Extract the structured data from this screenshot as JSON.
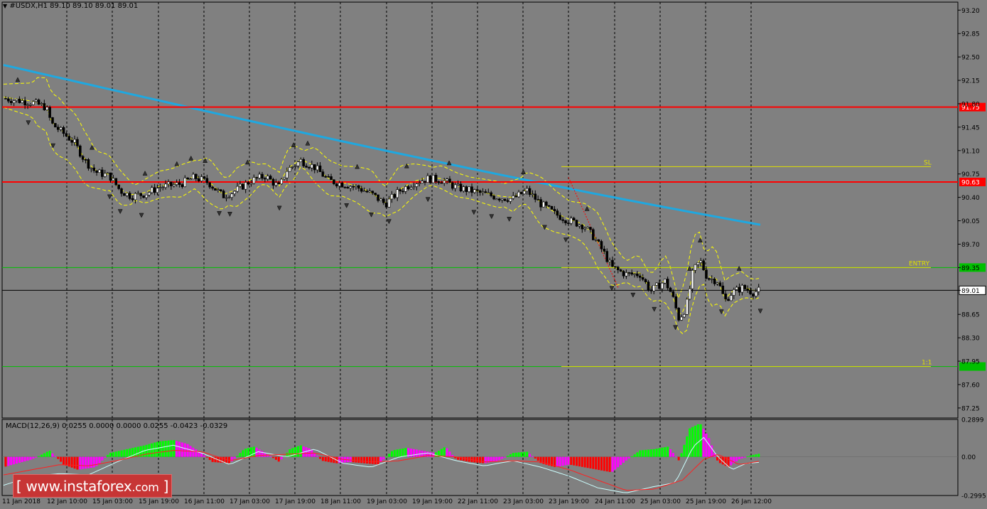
{
  "header": {
    "symbol_line": "#USDX,H1  89.10 89.10 89.01 89.01"
  },
  "macd": {
    "label": "MACD(12,26,9) 0.0255 0.0000 0.0000 0.0255 -0.0423 -0.0329"
  },
  "watermark": {
    "text": "www.instaforex",
    "suffix": ".com",
    "open_bracket": "[",
    "close_bracket": "]"
  },
  "colors": {
    "background": "#808080",
    "grid": "#000000",
    "ma_line": "#1fa8e0",
    "resistance_line": "#ff0000",
    "entry_line": "#00c000",
    "sl_line": "#e0e000",
    "bollinger": "#ffff00",
    "hist_up": "#00ff00",
    "hist_down": "#ff0000",
    "hist_up_weak": "#ff00ff"
  },
  "chart_data": [
    {
      "type": "candlestick",
      "title": "#USDX,H1",
      "ohlc_last": {
        "open": 89.1,
        "high": 89.1,
        "low": 89.01,
        "close": 89.01
      },
      "ylim": [
        87.1,
        93.32
      ],
      "y_ticks": [
        "93.20",
        "92.85",
        "92.50",
        "92.15",
        "91.80",
        "91.45",
        "91.10",
        "90.75",
        "90.40",
        "90.05",
        "89.70",
        "89.35",
        "89.01",
        "88.65",
        "88.30",
        "87.95",
        "87.60",
        "87.25"
      ],
      "x_tick_labels": [
        "11 Jan 2018",
        "12 Jan 10:00",
        "15 Jan 03:00",
        "15 Jan 19:00",
        "16 Jan 11:00",
        "17 Jan 03:00",
        "17 Jan 19:00",
        "18 Jan 11:00",
        "19 Jan 03:00",
        "19 Jan 19:00",
        "22 Jan 11:00",
        "23 Jan 03:00",
        "23 Jan 19:00",
        "24 Jan 11:00",
        "25 Jan 03:00",
        "25 Jan 19:00",
        "26 Jan 12:00"
      ],
      "price_path": [
        [
          0,
          91.88
        ],
        [
          20,
          91.85
        ],
        [
          40,
          91.82
        ],
        [
          60,
          91.75
        ],
        [
          68,
          91.5
        ],
        [
          80,
          91.4
        ],
        [
          100,
          91.22
        ],
        [
          115,
          90.95
        ],
        [
          130,
          90.78
        ],
        [
          150,
          90.72
        ],
        [
          165,
          90.5
        ],
        [
          180,
          90.42
        ],
        [
          200,
          90.45
        ],
        [
          220,
          90.55
        ],
        [
          250,
          90.6
        ],
        [
          270,
          90.7
        ],
        [
          290,
          90.62
        ],
        [
          310,
          90.42
        ],
        [
          325,
          90.48
        ],
        [
          350,
          90.65
        ],
        [
          370,
          90.72
        ],
        [
          390,
          90.55
        ],
        [
          400,
          90.8
        ],
        [
          420,
          90.95
        ],
        [
          440,
          90.85
        ],
        [
          460,
          90.65
        ],
        [
          480,
          90.6
        ],
        [
          500,
          90.55
        ],
        [
          520,
          90.45
        ],
        [
          540,
          90.3
        ],
        [
          560,
          90.5
        ],
        [
          580,
          90.62
        ],
        [
          600,
          90.68
        ],
        [
          620,
          90.66
        ],
        [
          640,
          90.55
        ],
        [
          660,
          90.5
        ],
        [
          680,
          90.45
        ],
        [
          700,
          90.4
        ],
        [
          720,
          90.38
        ],
        [
          740,
          90.5
        ],
        [
          760,
          90.3
        ],
        [
          780,
          90.15
        ],
        [
          800,
          90.05
        ],
        [
          820,
          89.98
        ],
        [
          835,
          89.8
        ],
        [
          850,
          89.55
        ],
        [
          860,
          89.35
        ],
        [
          880,
          89.25
        ],
        [
          900,
          89.25
        ],
        [
          915,
          89.0
        ],
        [
          935,
          89.15
        ],
        [
          945,
          88.95
        ],
        [
          955,
          88.58
        ],
        [
          965,
          88.75
        ],
        [
          975,
          89.3
        ],
        [
          985,
          89.45
        ],
        [
          995,
          89.2
        ],
        [
          1010,
          89.15
        ],
        [
          1020,
          88.85
        ],
        [
          1030,
          88.98
        ],
        [
          1045,
          89.05
        ],
        [
          1060,
          88.98
        ],
        [
          1070,
          89.01
        ]
      ],
      "moving_average": {
        "start": 92.38,
        "end": 89.99,
        "color": "#1fa8e0"
      },
      "horizontal_levels": [
        {
          "price": 91.75,
          "label": "91.75",
          "color": "#ff0000"
        },
        {
          "price": 90.63,
          "label": "90.63",
          "color": "#ff0000"
        },
        {
          "price": 90.86,
          "label": "SL",
          "color": "#e0e000"
        },
        {
          "price": 89.35,
          "label": "ENTRY",
          "color": "#00c000"
        },
        {
          "price": 87.87,
          "label": "1:1",
          "color": "#00c000"
        },
        {
          "price": 89.01,
          "label": "89.01",
          "color": "#000000"
        }
      ]
    },
    {
      "type": "bar",
      "title": "MACD(12,26,9)",
      "ylim": [
        -0.2995,
        0.2899
      ],
      "y_ticks": [
        "0.2899",
        "0.00",
        "-0.2995"
      ],
      "last_values": {
        "main": 0.0255,
        "signal": -0.0329,
        "histogram": 0.0255
      },
      "histogram_path": [
        [
          0,
          -0.08
        ],
        [
          20,
          -0.05
        ],
        [
          40,
          -0.02
        ],
        [
          55,
          0.02
        ],
        [
          65,
          0.05
        ],
        [
          85,
          -0.06
        ],
        [
          105,
          -0.1
        ],
        [
          130,
          -0.08
        ],
        [
          150,
          0.03
        ],
        [
          175,
          0.06
        ],
        [
          200,
          0.09
        ],
        [
          220,
          0.12
        ],
        [
          240,
          0.13
        ],
        [
          260,
          0.1
        ],
        [
          280,
          0.03
        ],
        [
          295,
          -0.04
        ],
        [
          320,
          -0.05
        ],
        [
          340,
          0.06
        ],
        [
          355,
          0.08
        ],
        [
          370,
          0.03
        ],
        [
          390,
          -0.04
        ],
        [
          405,
          0.06
        ],
        [
          420,
          0.09
        ],
        [
          435,
          0.06
        ],
        [
          450,
          -0.03
        ],
        [
          470,
          -0.05
        ],
        [
          490,
          -0.04
        ],
        [
          510,
          -0.05
        ],
        [
          530,
          -0.06
        ],
        [
          550,
          0.05
        ],
        [
          570,
          0.07
        ],
        [
          590,
          0.05
        ],
        [
          610,
          0.03
        ],
        [
          625,
          0.08
        ],
        [
          640,
          -0.02
        ],
        [
          660,
          -0.04
        ],
        [
          680,
          -0.05
        ],
        [
          700,
          -0.03
        ],
        [
          720,
          0.03
        ],
        [
          740,
          0.04
        ],
        [
          760,
          -0.05
        ],
        [
          780,
          -0.08
        ],
        [
          800,
          -0.06
        ],
        [
          820,
          -0.08
        ],
        [
          840,
          -0.1
        ],
        [
          860,
          -0.12
        ],
        [
          880,
          -0.03
        ],
        [
          900,
          0.05
        ],
        [
          920,
          0.06
        ],
        [
          940,
          0.08
        ],
        [
          955,
          -0.03
        ],
        [
          970,
          0.22
        ],
        [
          985,
          0.26
        ],
        [
          998,
          0.14
        ],
        [
          1010,
          -0.04
        ],
        [
          1025,
          -0.08
        ],
        [
          1040,
          -0.02
        ],
        [
          1055,
          0.01
        ],
        [
          1070,
          0.0255
        ]
      ],
      "signal_path": [
        [
          0,
          -0.14
        ],
        [
          40,
          -0.1
        ],
        [
          80,
          -0.06
        ],
        [
          120,
          -0.07
        ],
        [
          160,
          -0.03
        ],
        [
          200,
          0.02
        ],
        [
          240,
          0.05
        ],
        [
          280,
          0.04
        ],
        [
          320,
          -0.03
        ],
        [
          360,
          0.01
        ],
        [
          400,
          0.02
        ],
        [
          440,
          0.03
        ],
        [
          480,
          -0.02
        ],
        [
          520,
          -0.04
        ],
        [
          560,
          -0.03
        ],
        [
          600,
          0.01
        ],
        [
          640,
          0.0
        ],
        [
          680,
          -0.04
        ],
        [
          720,
          -0.03
        ],
        [
          760,
          -0.04
        ],
        [
          800,
          -0.1
        ],
        [
          840,
          -0.18
        ],
        [
          880,
          -0.26
        ],
        [
          920,
          -0.25
        ],
        [
          960,
          -0.18
        ],
        [
          990,
          -0.02
        ],
        [
          1010,
          0.02
        ],
        [
          1040,
          -0.06
        ],
        [
          1070,
          -0.0329
        ]
      ],
      "main_path": [
        [
          0,
          -0.22
        ],
        [
          40,
          -0.15
        ],
        [
          80,
          -0.13
        ],
        [
          120,
          -0.14
        ],
        [
          160,
          -0.04
        ],
        [
          200,
          0.05
        ],
        [
          240,
          0.09
        ],
        [
          280,
          0.03
        ],
        [
          320,
          -0.06
        ],
        [
          360,
          0.04
        ],
        [
          400,
          0.0
        ],
        [
          440,
          0.06
        ],
        [
          480,
          -0.05
        ],
        [
          520,
          -0.08
        ],
        [
          560,
          0.0
        ],
        [
          600,
          0.03
        ],
        [
          640,
          -0.03
        ],
        [
          680,
          -0.07
        ],
        [
          720,
          -0.03
        ],
        [
          760,
          -0.08
        ],
        [
          800,
          -0.15
        ],
        [
          840,
          -0.24
        ],
        [
          880,
          -0.28
        ],
        [
          920,
          -0.23
        ],
        [
          950,
          -0.2
        ],
        [
          975,
          0.08
        ],
        [
          990,
          0.15
        ],
        [
          1010,
          0.0
        ],
        [
          1030,
          -0.1
        ],
        [
          1050,
          -0.05
        ],
        [
          1070,
          -0.0423
        ]
      ]
    }
  ]
}
